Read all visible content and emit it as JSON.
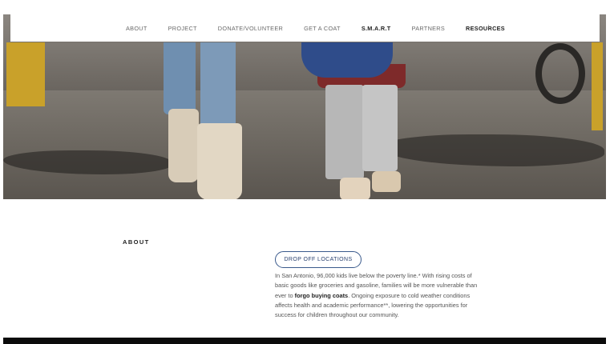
{
  "nav": {
    "items": [
      {
        "label": "ABOUT",
        "emphasis": false
      },
      {
        "label": "PROJECT",
        "emphasis": false
      },
      {
        "label": "DONATE/VOLUNTEER",
        "emphasis": false
      },
      {
        "label": "GET A COAT",
        "emphasis": false
      },
      {
        "label": "S.M.A.R.T",
        "emphasis": true
      },
      {
        "label": "PARTNERS",
        "emphasis": false
      },
      {
        "label": "RESOURCES",
        "emphasis": true
      }
    ],
    "scroll_icon": "arrow-down-icon",
    "scroll_glyph": "↓"
  },
  "about": {
    "heading": "ABOUT",
    "button_label": "DROP OFF LOCATIONS",
    "text_part1": "In San Antonio, 96,000 kids live below the poverty line.* With rising costs of basic goods like groceries and gasoline, families will be more vulnerable than ever to ",
    "text_bold": "forgo buying coats",
    "text_part2": ". Ongoing exposure to cold weather conditions affects health and academic performance**, lowering the opportunities for success for children throughout our community."
  },
  "colors": {
    "button_border": "#3a5a8c",
    "footer": "#0b0b0b"
  }
}
